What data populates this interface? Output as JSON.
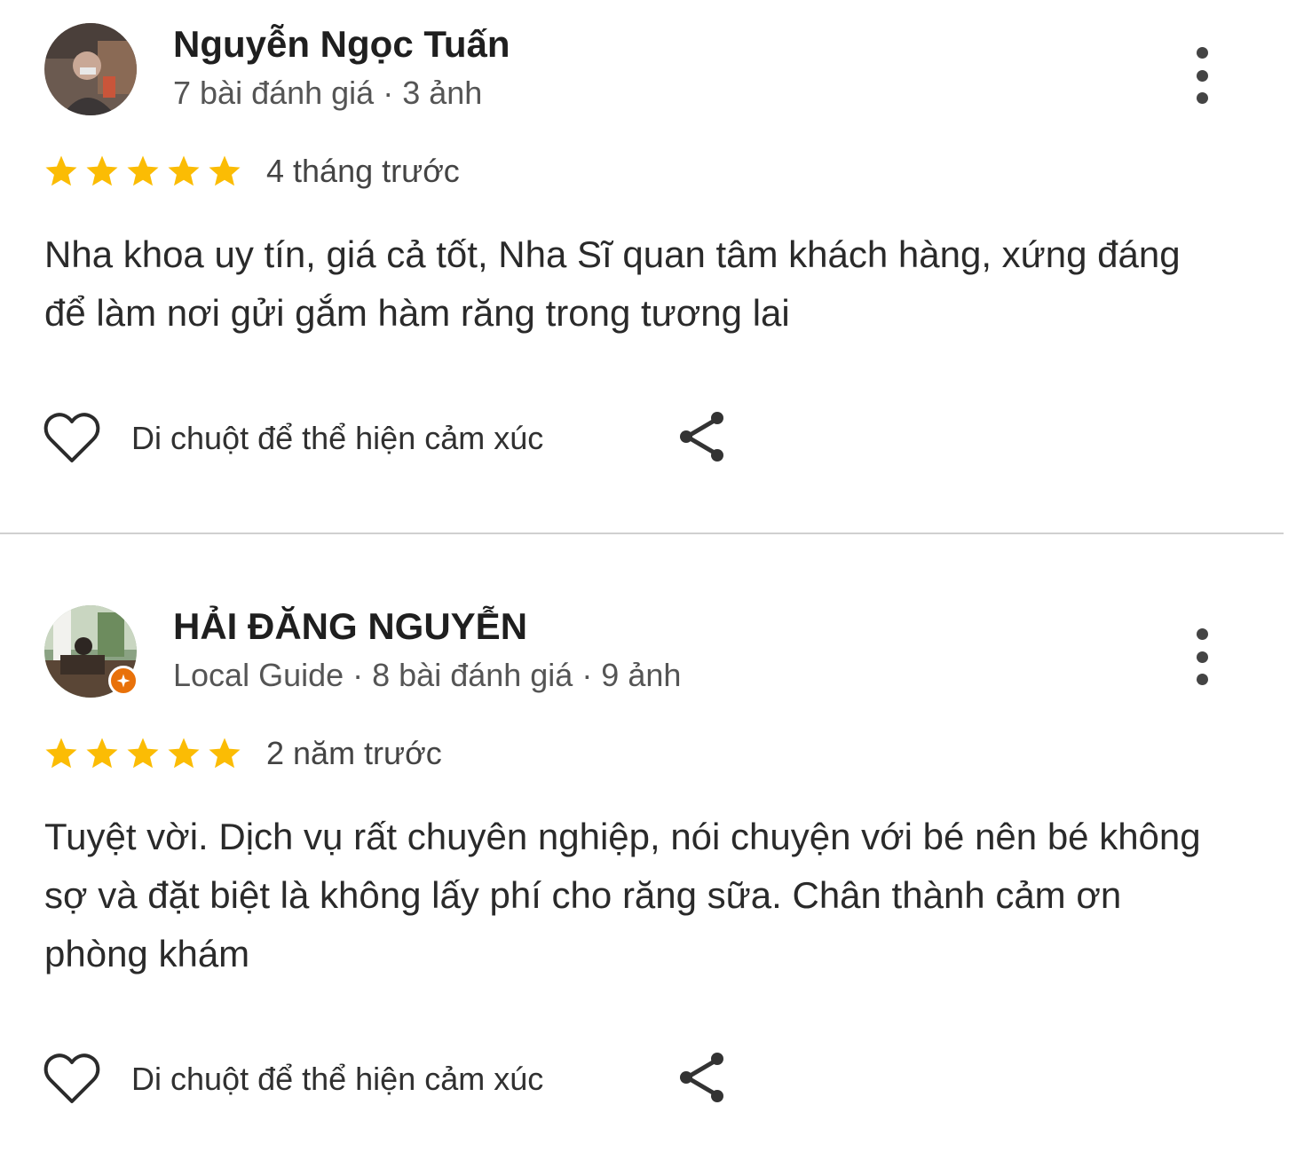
{
  "reviews": [
    {
      "name": "Nguyễn Ngọc Tuấn",
      "meta": "7 bài đánh giá · 3 ảnh",
      "rating": 5,
      "time": "4 tháng trước",
      "text": "Nha khoa uy tín, giá cả tốt, Nha Sĩ quan tâm khách hàng, xứng đáng để làm nơi gửi gắm hàm răng trong tương lai",
      "reaction_label": "Di chuột để thể hiện cảm xúc",
      "local_guide": false
    },
    {
      "name": "HẢI ĐĂNG NGUYỄN",
      "meta": "Local Guide · 8 bài đánh giá · 9 ảnh",
      "rating": 5,
      "time": "2 năm trước",
      "text": "Tuyệt vời. Dịch vụ rất chuyên nghiệp, nói chuyện với bé nên bé không sợ và đặt biệt là không lấy phí cho răng sữa. Chân thành cảm ơn phòng khám",
      "reaction_label": "Di chuột để thể hiện cảm xúc",
      "local_guide": true
    }
  ],
  "colors": {
    "star": "#fbbc04",
    "badge": "#e8710a",
    "divider": "#d0d0d0"
  },
  "icons": [
    "heart-icon",
    "share-icon",
    "more-vert-icon",
    "star-icon",
    "local-guide-badge-icon"
  ]
}
